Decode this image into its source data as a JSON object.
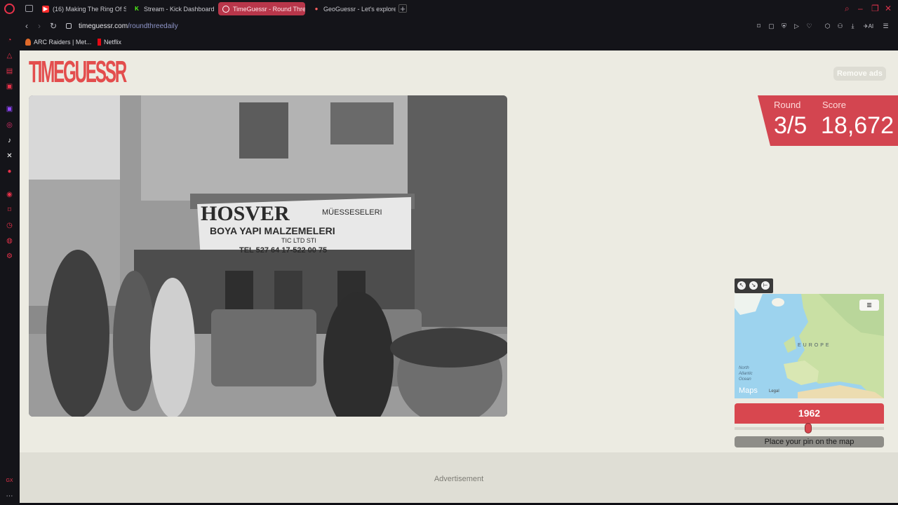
{
  "tabs": [
    {
      "label": "(16) Making The Ring Of S",
      "icon": "youtube-icon",
      "color": "#ff2b2b"
    },
    {
      "label": "Stream - Kick Dashboard",
      "icon": "kick-icon",
      "color": "#53fc18"
    },
    {
      "label": "TimeGuessr - Round Thre",
      "icon": "timeguessr-icon",
      "color": "#ffffff",
      "active": true
    },
    {
      "label": "GeoGuessr - Let's explore",
      "icon": "geoguessr-icon",
      "color": "#ff6060"
    }
  ],
  "address": {
    "domain": "timeguessr.com",
    "path": "/roundthreedaily"
  },
  "bookmarks": [
    {
      "label": "ARC Raiders | Met...",
      "icon": "arc-raiders-icon"
    },
    {
      "label": "Netflix",
      "icon": "netflix-icon"
    }
  ],
  "page": {
    "logo": "TIMEGUESSR",
    "remove_ads": "Remove ads",
    "round_label": "Round",
    "round_value": "3/5",
    "score_label": "Score",
    "score_value": "18,672",
    "map_label_region": "EUROPE",
    "map_label_ocean": "North\nAtlantic\nOcean",
    "map_brand": "Maps",
    "map_legal": "Legal",
    "year": "1962",
    "place_pin": "Place your pin on the map",
    "ad_label": "Advertisement"
  },
  "photo": {
    "sign_line1": "HOSVER",
    "sign_line1b": "MÜESSESELERI",
    "sign_line2": "BOYA YAPI MALZEMELERI",
    "sign_line3": "TIC LTD STI",
    "sign_line4": "TEL 527 64 17-522 00 75"
  },
  "colors": {
    "accent": "#d8474f",
    "page_bg": "#ecebe2",
    "browser_bg": "#141419"
  }
}
